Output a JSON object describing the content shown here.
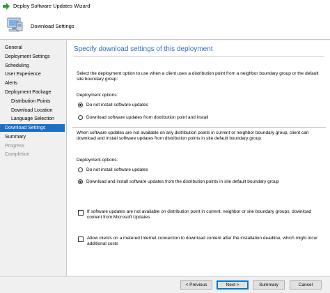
{
  "window": {
    "title": "Deploy Software Updates Wizard"
  },
  "header": {
    "title": "Download Settings"
  },
  "nav": {
    "items": [
      {
        "label": "General",
        "level": 0,
        "state": "normal"
      },
      {
        "label": "Deployment Settings",
        "level": 0,
        "state": "normal"
      },
      {
        "label": "Scheduling",
        "level": 0,
        "state": "normal"
      },
      {
        "label": "User Experience",
        "level": 0,
        "state": "normal"
      },
      {
        "label": "Alerts",
        "level": 0,
        "state": "normal"
      },
      {
        "label": "Deployment Package",
        "level": 0,
        "state": "normal"
      },
      {
        "label": "Distribution Points",
        "level": 1,
        "state": "normal"
      },
      {
        "label": "Download Location",
        "level": 1,
        "state": "normal"
      },
      {
        "label": "Language Selection",
        "level": 1,
        "state": "normal"
      },
      {
        "label": "Download Settings",
        "level": 0,
        "state": "active"
      },
      {
        "label": "Summary",
        "level": 0,
        "state": "normal"
      },
      {
        "label": "Progress",
        "level": 0,
        "state": "disabled"
      },
      {
        "label": "Completion",
        "level": 0,
        "state": "disabled"
      }
    ]
  },
  "content": {
    "title": "Specify download settings of this deployment",
    "section1": {
      "description": "Select the deployment option to use when a client uses a distribution point from a neighbor boundary group or the default site boundary group:",
      "group_label": "Deployment options:",
      "options": [
        {
          "label": "Do not install software updates",
          "checked": true
        },
        {
          "label": "Download software updates from distribution point and install",
          "checked": false
        }
      ]
    },
    "section2": {
      "description": "When software updates are not available on any distribution points in current or neighbor boundary group, client can download and install software updates from distribution points in site default boundary group.",
      "group_label": "Deployment options:",
      "options": [
        {
          "label": "Do not install software updates",
          "checked": false
        },
        {
          "label": "Download and install software updates from the distribution points in site default boundary group",
          "checked": true
        }
      ]
    },
    "checkboxes": [
      {
        "label": "If software updates are not available on distribution point in current, neighbor or site boundary groups, download content from Microsoft Updates",
        "checked": false
      },
      {
        "label": "Allow clients on a metered Internet connection to download content after the installation deadline, which might incur additional costs",
        "checked": false
      }
    ]
  },
  "footer": {
    "previous_label": "< Previous",
    "next_label": "Next >",
    "summary_label": "Summary",
    "cancel_label": "Cancel"
  },
  "colors": {
    "accent": "#1c6ec7",
    "title_text": "#2f6ec4",
    "window_bg": "#f0f0f0"
  }
}
